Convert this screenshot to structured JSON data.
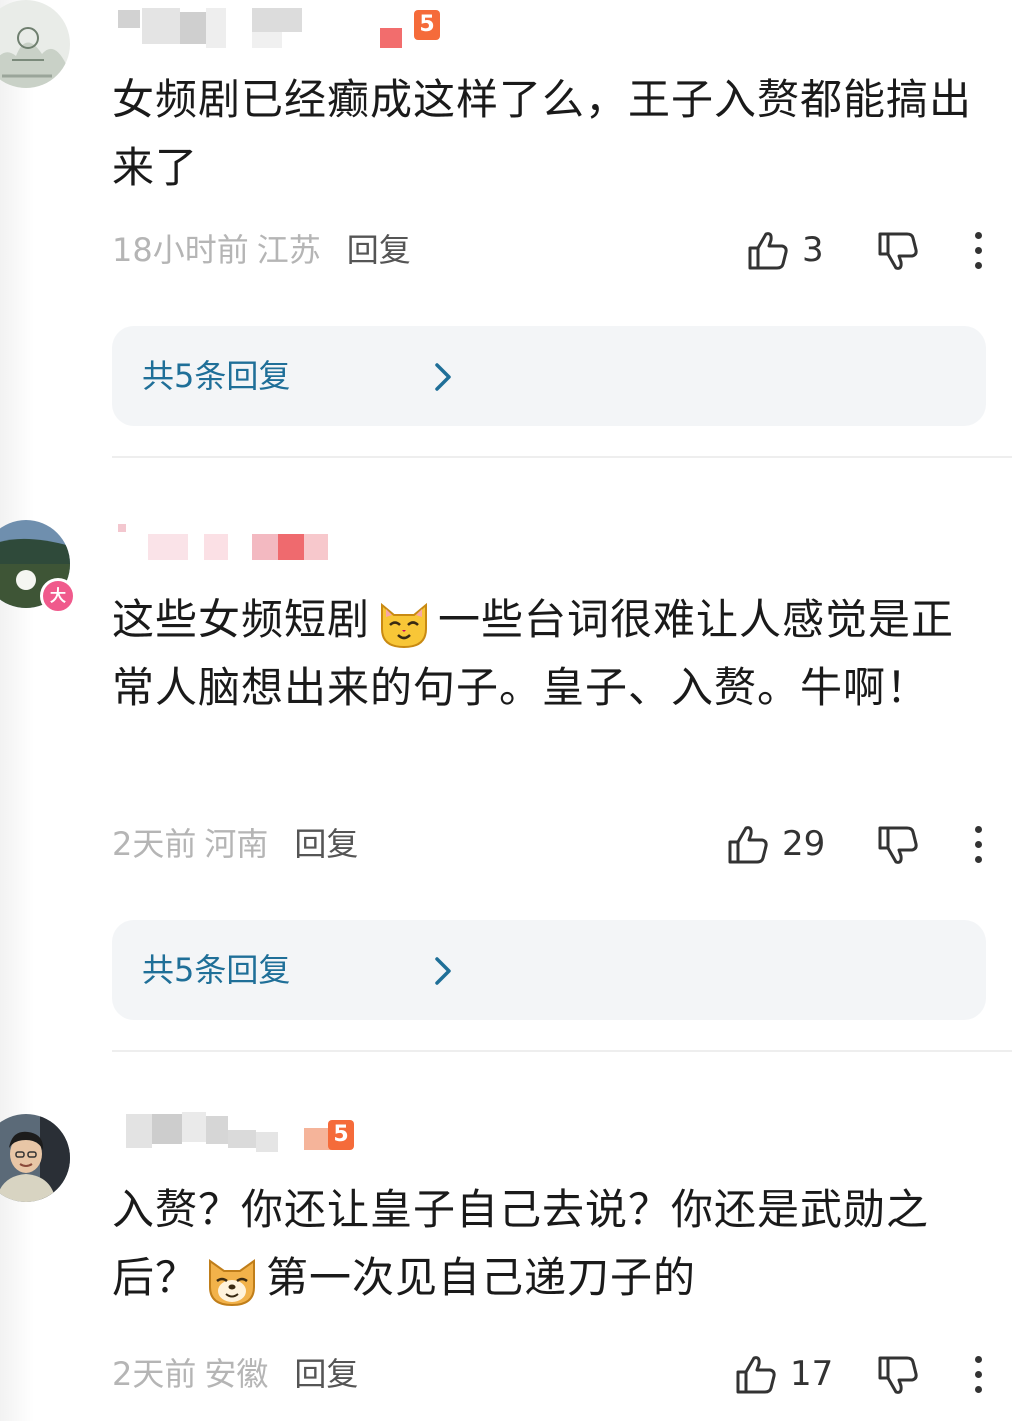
{
  "comments": [
    {
      "text": "女频剧已经癫成这样了么，王子入赘都能搞出来了",
      "time": "18小时前",
      "location": "江苏",
      "reply_label": "回复",
      "likes": "3",
      "fan_badge": "5"
    },
    {
      "text_part1": "这些女频短剧",
      "text_part2": "一些台词很难让人感觉是正常人脑想出来的句子。皇子、入赘。牛啊！",
      "time": "2天前",
      "location": "河南",
      "reply_label": "回复",
      "likes": "29",
      "level_badge": "大"
    },
    {
      "text_part1": "入赘？你还让皇子自己去说？你还是武勋之后？",
      "text_part2": "第一次见自己递刀子的",
      "time": "2天前",
      "location": "安徽",
      "reply_label": "回复",
      "likes": "17",
      "fan_badge": "5"
    }
  ],
  "replies_summary": [
    "共5条回复",
    "共5条回复"
  ],
  "colors": {
    "reply_link": "#1f6f98",
    "reply_box_bg": "#f3f5f7",
    "meta_gray": "#b5b5b5",
    "level_badge": "#f05a8c",
    "fan_badge": "#f56b3a"
  },
  "icons": [
    "thumbs-up-icon",
    "thumbs-down-icon",
    "more-vertical-icon",
    "chevron-right-icon",
    "cat-emoji-icon",
    "dog-emoji-icon"
  ]
}
